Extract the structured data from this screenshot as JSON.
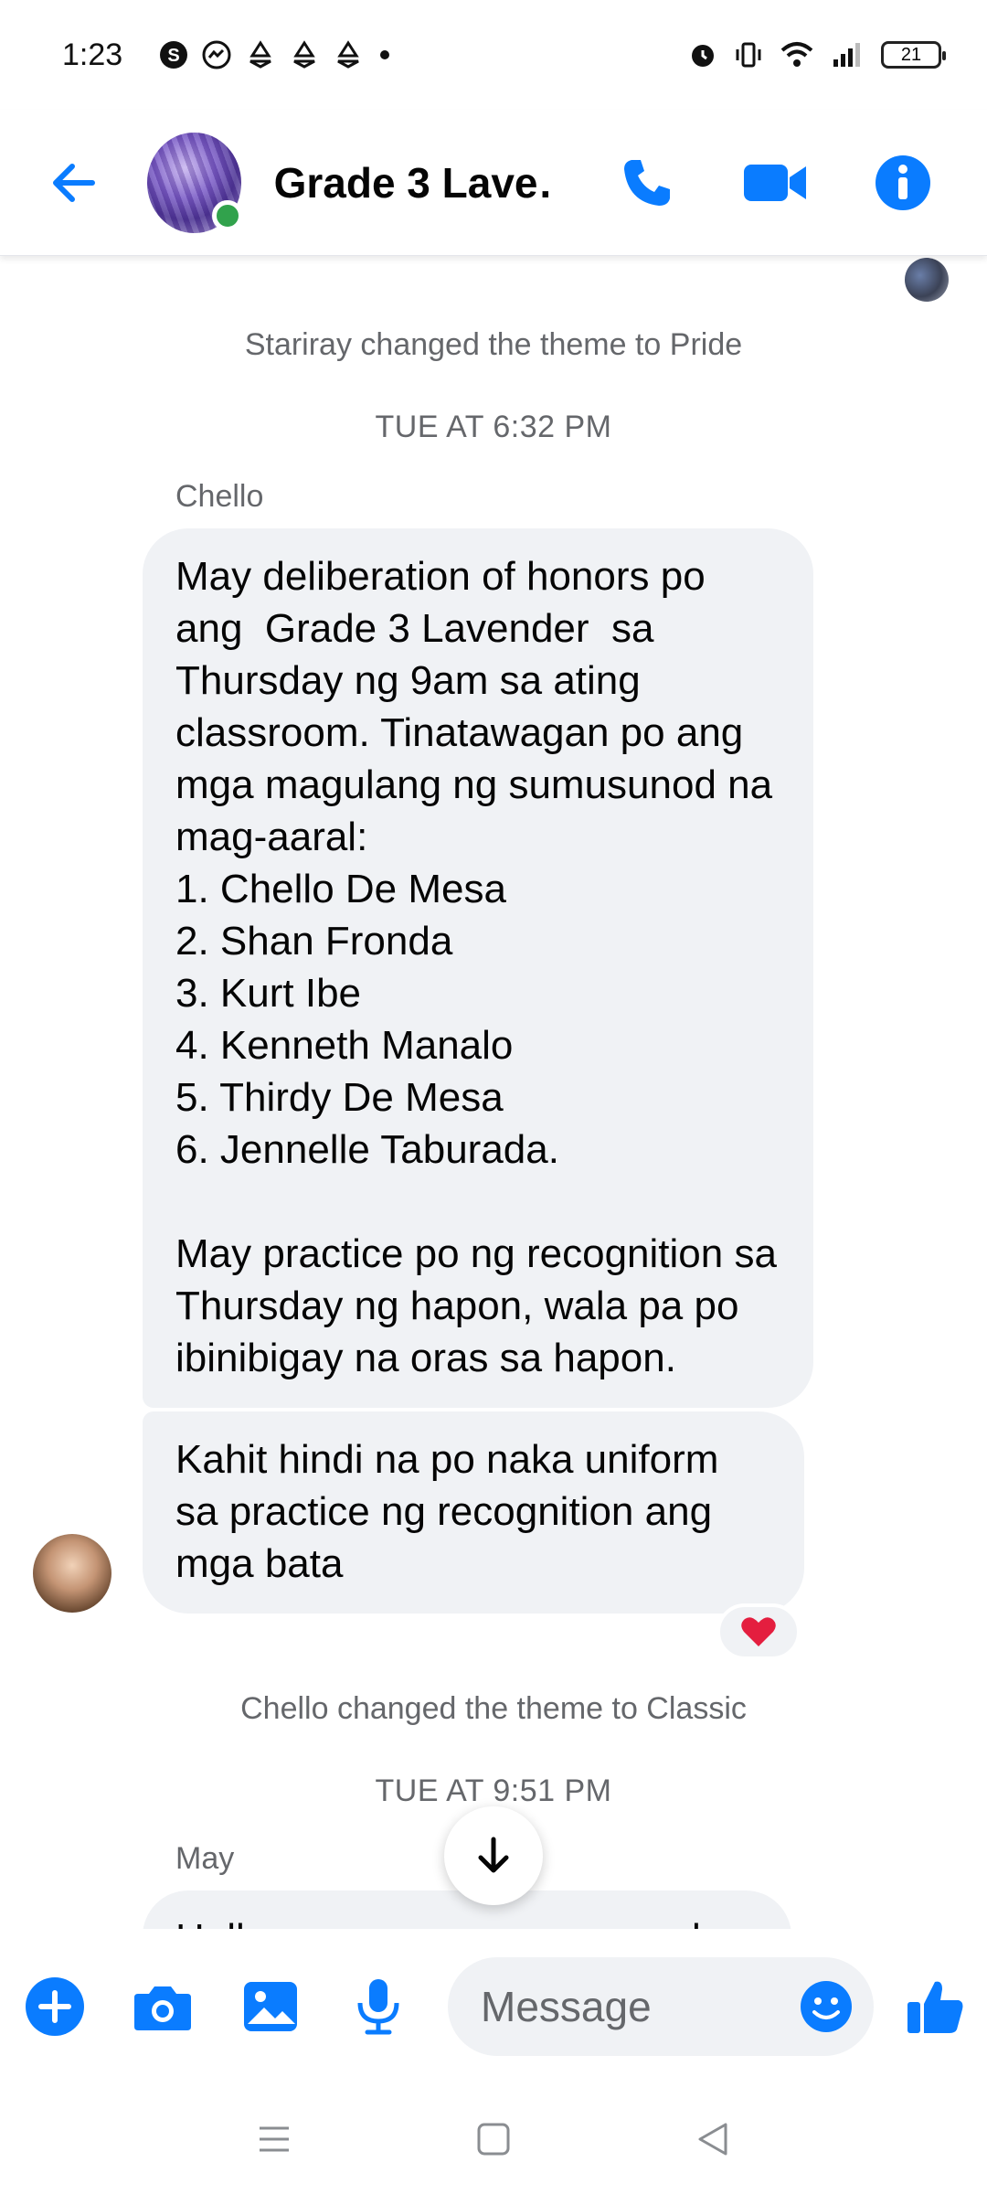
{
  "status_bar": {
    "time": "1:23",
    "battery": "21",
    "left_icons": [
      "skype-icon",
      "messenger-icon",
      "recycle-icon",
      "recycle-icon",
      "recycle-icon",
      "dot-icon"
    ],
    "right_icons": [
      "alarm-icon",
      "vibrate-icon",
      "wifi-icon",
      "signal-icon",
      "battery-icon"
    ]
  },
  "header": {
    "title": "Grade 3 Lave…",
    "accent_color": "#0a7cff"
  },
  "chat": {
    "system_messages": [
      "Stariray changed the theme to Pride",
      "Chello changed the theme to Classic"
    ],
    "timestamps": [
      "TUE AT 6:32 PM",
      "TUE AT 9:51 PM"
    ],
    "messages": [
      {
        "sender": "Chello",
        "text": "May deliberation of honors po ang  Grade 3 Lavender  sa Thursday ng 9am sa ating classroom. Tinatawagan po ang mga magulang ng sumusunod na mag-aaral:\n1. Chello De Mesa\n2. Shan Fronda\n3. Kurt Ibe\n4. Kenneth Manalo\n5. Thirdy De Mesa\n6. Jennelle Taburada.\n\nMay practice po ng recognition sa Thursday ng hapon, wala pa po ibinibigay na oras sa hapon."
      },
      {
        "sender": "Chello",
        "text": "Kahit hindi na po naka uniform sa practice ng recognition ang mga bata",
        "reaction": "heart"
      },
      {
        "sender": "May",
        "text": "Hello po mayroon pong naook"
      }
    ]
  },
  "composer": {
    "placeholder": "Message"
  }
}
